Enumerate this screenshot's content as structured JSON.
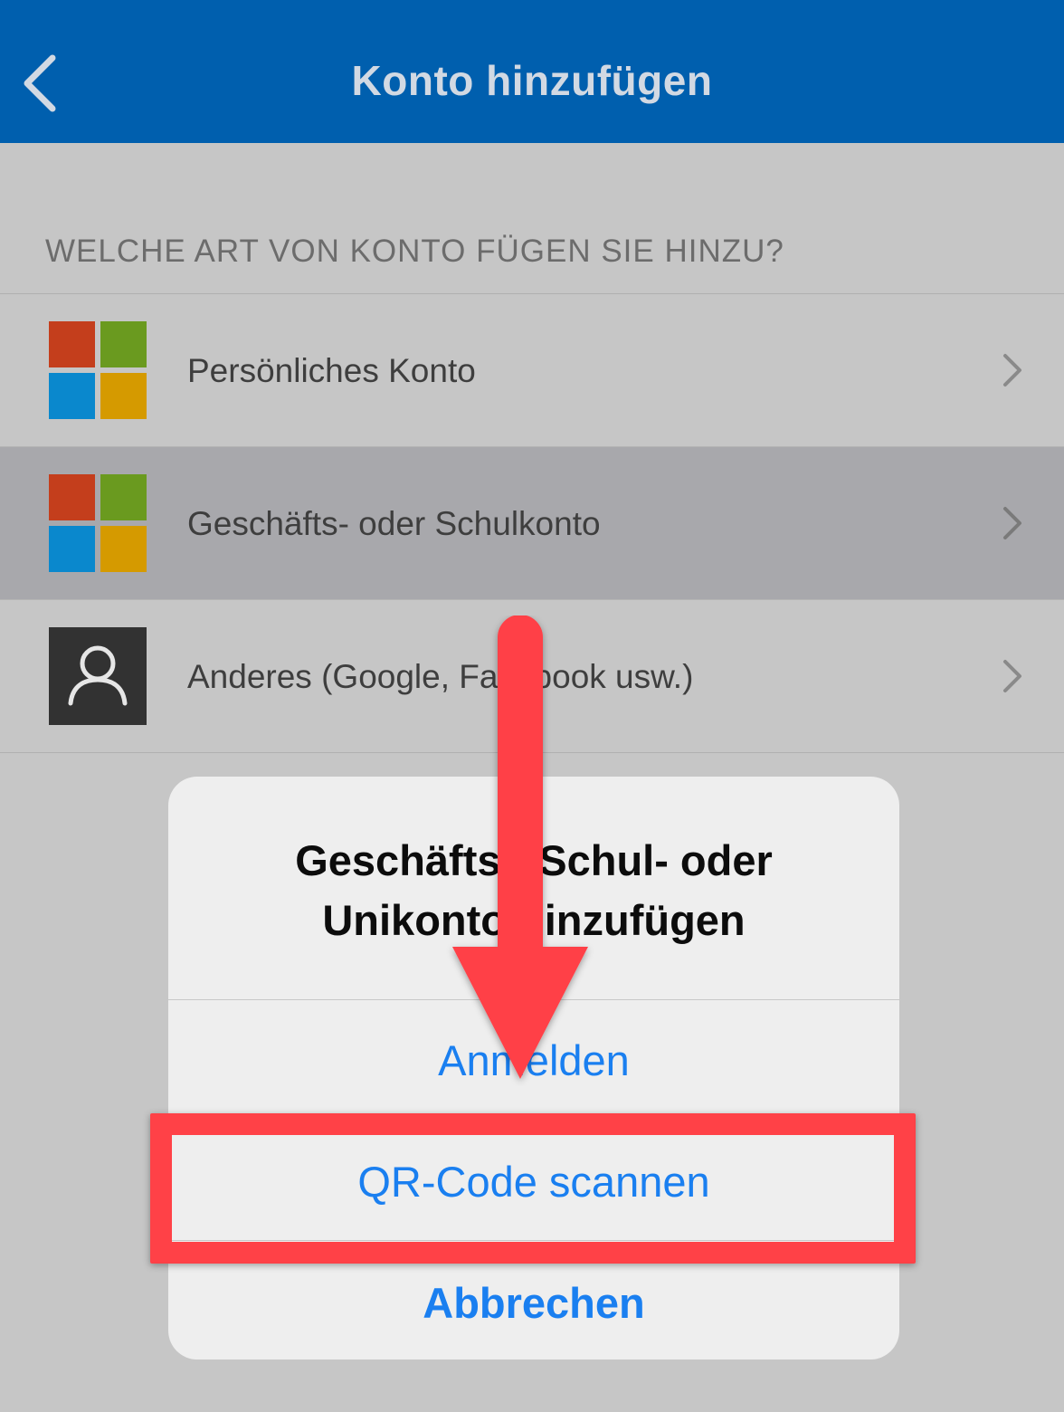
{
  "navbar": {
    "title": "Konto hinzufügen",
    "color": "#005fae",
    "back_icon": "chevron-left-icon"
  },
  "section": {
    "header": "WELCHE ART VON KONTO FÜGEN SIE HINZU?"
  },
  "accounts": [
    {
      "label": "Persönliches Konto",
      "icon": "microsoft-logo-icon",
      "selected": false
    },
    {
      "label": "Geschäfts- oder Schulkonto",
      "icon": "microsoft-logo-icon",
      "selected": true
    },
    {
      "label": "Anderes (Google, Facebook usw.)",
      "icon": "user-icon",
      "selected": false
    }
  ],
  "sheet": {
    "title": "Geschäfts-, Schul- oder Unikonto hinzufügen",
    "buttons": {
      "sign_in": "Anmelden",
      "scan_qr": "QR-Code scannen",
      "cancel": "Abbrechen"
    }
  },
  "annotation": {
    "highlight_color": "#ff4147",
    "highlight_target": "QR-Code scannen"
  },
  "colors": {
    "ms_red": "#c43e1c",
    "ms_green": "#6a9a1f",
    "ms_blue": "#0a88cd",
    "ms_yellow": "#d59a00",
    "action_blue": "#1a7ff0"
  }
}
